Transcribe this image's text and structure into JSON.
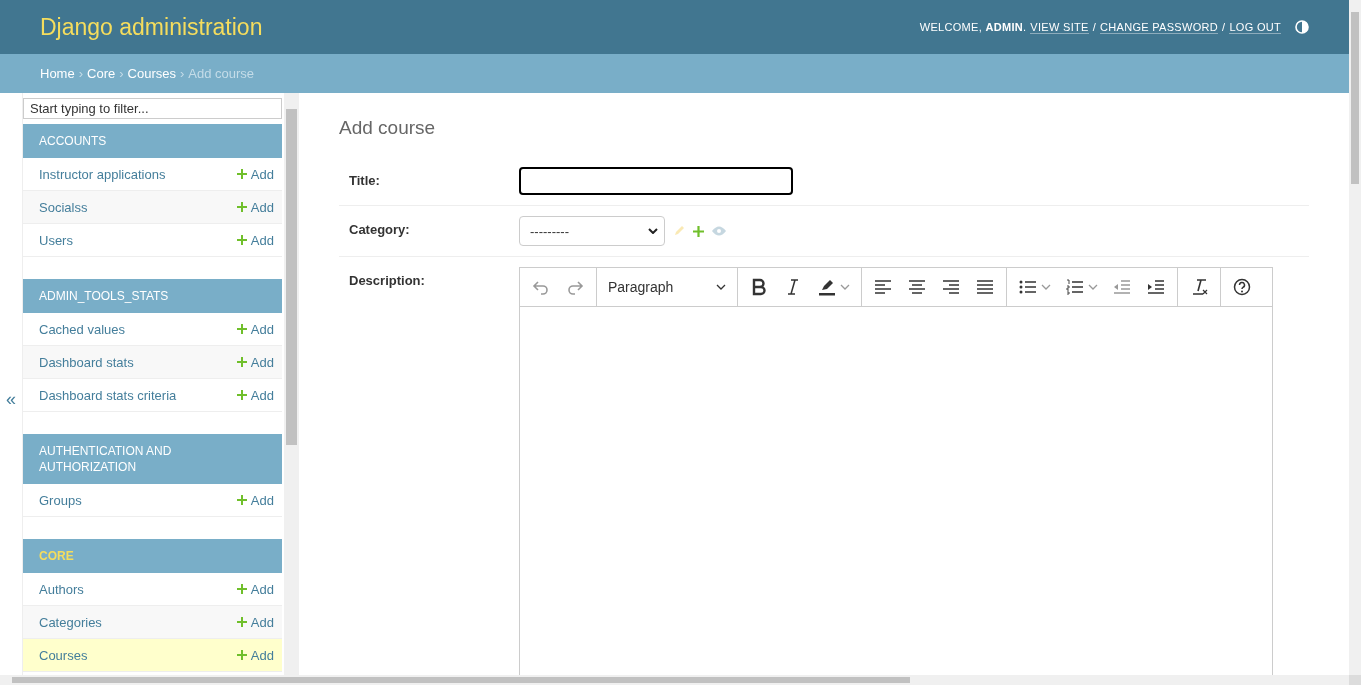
{
  "header": {
    "site_name": "Django administration",
    "welcome": "WELCOME, **ADMIN**.",
    "links": [
      "VIEW SITE",
      "CHANGE PASSWORD",
      "LOG OUT"
    ],
    "separator": "/"
  },
  "breadcrumbs": {
    "separator": "›",
    "items": [
      {
        "label": "Home",
        "link": true
      },
      {
        "label": "Core",
        "link": true
      },
      {
        "label": "Courses",
        "link": true
      },
      {
        "label": "Add course",
        "link": false
      }
    ]
  },
  "sidebar": {
    "toggle": "«",
    "filter": {
      "placeholder": "Start typing to filter..."
    },
    "modules": [
      {
        "name": "ACCOUNTS",
        "selected": false,
        "models": [
          {
            "name": "Instructor applications",
            "add": "Add",
            "selected": false
          },
          {
            "name": "Socialss",
            "add": "Add",
            "selected": false
          },
          {
            "name": "Users",
            "add": "Add",
            "selected": false
          }
        ]
      },
      {
        "name": "ADMIN_TOOLS_STATS",
        "selected": false,
        "models": [
          {
            "name": "Cached values",
            "add": "Add",
            "selected": false
          },
          {
            "name": "Dashboard stats",
            "add": "Add",
            "selected": false
          },
          {
            "name": "Dashboard stats criteria",
            "add": "Add",
            "selected": false
          }
        ]
      },
      {
        "name": "AUTHENTICATION AND AUTHORIZATION",
        "selected": false,
        "models": [
          {
            "name": "Groups",
            "add": "Add",
            "selected": false
          }
        ]
      },
      {
        "name": "CORE",
        "selected": true,
        "models": [
          {
            "name": "Authors",
            "add": "Add",
            "selected": false
          },
          {
            "name": "Categories",
            "add": "Add",
            "selected": false
          },
          {
            "name": "Courses",
            "add": "Add",
            "selected": true
          }
        ]
      }
    ]
  },
  "content": {
    "title": "Add course",
    "fields": [
      {
        "kind": "text",
        "label": "Title:",
        "focused": true
      },
      {
        "kind": "select",
        "label": "Category:",
        "value": "---------",
        "actions": [
          {
            "kind": "change",
            "disabled": true
          },
          {
            "kind": "add",
            "disabled": false
          },
          {
            "kind": "view",
            "disabled": true
          }
        ]
      },
      {
        "kind": "editor",
        "label": "Description:",
        "toolbar": [
          [
            {
              "kind": "undo",
              "disabled": true
            },
            {
              "kind": "redo",
              "disabled": true
            }
          ],
          [
            {
              "kind": "heading",
              "label": "Paragraph",
              "disabled": false
            }
          ],
          [
            {
              "kind": "bold",
              "disabled": false
            },
            {
              "kind": "italic",
              "disabled": false
            },
            {
              "kind": "highlight",
              "disabled": false,
              "dropdown": true
            }
          ],
          [
            {
              "kind": "align-left",
              "disabled": false
            },
            {
              "kind": "align-center",
              "disabled": false
            },
            {
              "kind": "align-right",
              "disabled": false
            },
            {
              "kind": "justify",
              "disabled": false
            }
          ],
          [
            {
              "kind": "bulleted-list",
              "disabled": false,
              "dropdown": true
            },
            {
              "kind": "numbered-list",
              "disabled": false,
              "dropdown": true
            },
            {
              "kind": "outdent",
              "disabled": true
            },
            {
              "kind": "indent",
              "disabled": false
            }
          ],
          [
            {
              "kind": "remove-format",
              "disabled": false
            }
          ],
          [
            {
              "kind": "help",
              "disabled": false
            }
          ]
        ]
      }
    ]
  }
}
